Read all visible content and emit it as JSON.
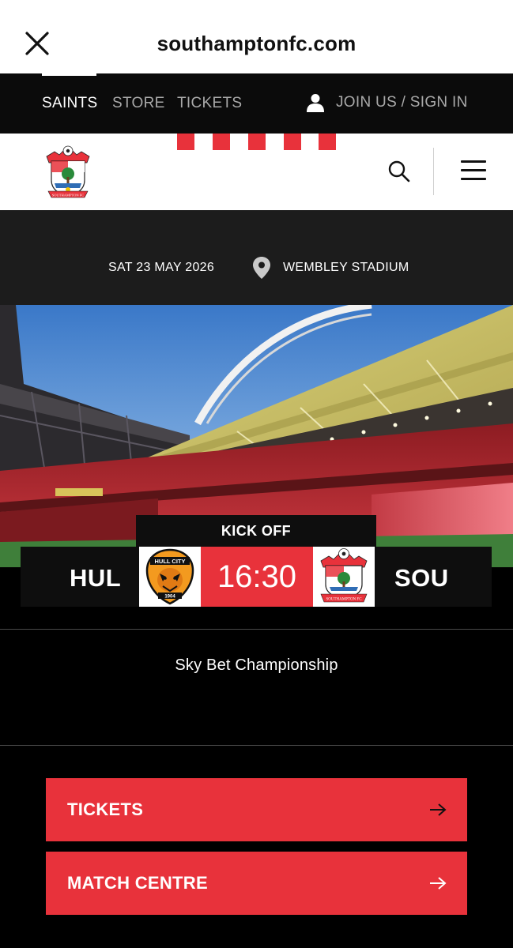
{
  "browser": {
    "domain": "southamptonfc.com",
    "close_icon": "close-icon"
  },
  "topnav": {
    "items": [
      {
        "label": "SAINTS",
        "active": true
      },
      {
        "label": "STORE",
        "active": false
      },
      {
        "label": "TICKETS",
        "active": false
      }
    ],
    "account_label": "JOIN US / SIGN IN",
    "account_icon": "user-icon"
  },
  "header": {
    "logo": "southampton-fc-crest",
    "search_icon": "search-icon",
    "menu_icon": "hamburger-menu-icon"
  },
  "match": {
    "date": "SAT 23 MAY 2026",
    "venue": "WEMBLEY STADIUM",
    "kickoff_label": "KICK OFF",
    "kickoff_time": "16:30",
    "home": {
      "short": "HUL",
      "badge_text": "HULL CITY",
      "badge_year": "1904"
    },
    "away": {
      "short": "SOU",
      "badge_text": "SOUTHAMPTON FC"
    },
    "competition": "Sky Bet Championship"
  },
  "actions": [
    {
      "label": "TICKETS"
    },
    {
      "label": "MATCH CENTRE"
    }
  ],
  "colors": {
    "brand_red": "#e8323b",
    "nav_bg": "#0b0b0b",
    "info_bg": "#1c1c1c"
  }
}
